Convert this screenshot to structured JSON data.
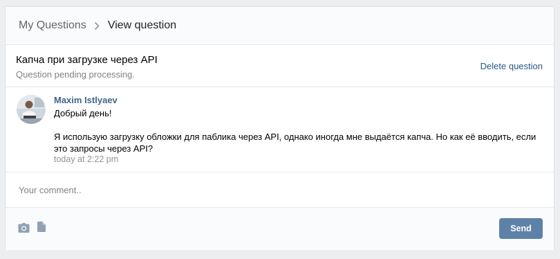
{
  "breadcrumb": {
    "parent": "My Questions",
    "current": "View question"
  },
  "question": {
    "title": "Капча при загрузке через API",
    "status": "Question pending processing.",
    "delete_label": "Delete question"
  },
  "post": {
    "author": "Maxim Istlyaev",
    "message": "Добрый день!\n\nЯ использую загрузку обложки для паблика через API, однако иногда мне выдаётся капча. Но как её вводить, если это запросы через API?",
    "time": "today at 2:22 pm"
  },
  "comment": {
    "placeholder": "Your comment.."
  },
  "footer": {
    "icons": [
      "camera-icon",
      "document-icon"
    ],
    "send_label": "Send"
  },
  "colors": {
    "link": "#2a5885",
    "author": "#42648b",
    "button": "#5e81a8",
    "muted": "#828282"
  }
}
